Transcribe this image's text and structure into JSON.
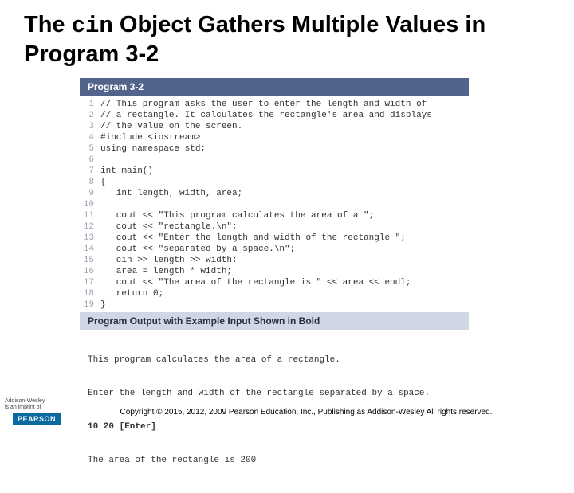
{
  "title": {
    "before": "The ",
    "mono": "cin",
    "after": " Object Gathers Multiple Values in Program 3-2"
  },
  "program_label": "Program 3-2",
  "code": [
    "// This program asks the user to enter the length and width of",
    "// a rectangle. It calculates the rectangle's area and displays",
    "// the value on the screen.",
    "#include <iostream>",
    "using namespace std;",
    "",
    "int main()",
    "{",
    "   int length, width, area;",
    "",
    "   cout << \"This program calculates the area of a \";",
    "   cout << \"rectangle.\\n\";",
    "   cout << \"Enter the length and width of the rectangle \";",
    "   cout << \"separated by a space.\\n\";",
    "   cin >> length >> width;",
    "   area = length * width;",
    "   cout << \"The area of the rectangle is \" << area << endl;",
    "   return 0;",
    "}"
  ],
  "output_label": "Program Output with Example Input Shown in Bold",
  "output": {
    "l1": "This program calculates the area of a rectangle.",
    "l2": "Enter the length and width of the rectangle separated by a space.",
    "l3_bold": "10 20 [Enter]",
    "l4": "The area of the rectangle is 200"
  },
  "brand": {
    "aw1": "Addison-Wesley",
    "aw2": "is an imprint of",
    "pearson": "PEARSON"
  },
  "copyright": "Copyright © 2015, 2012, 2009 Pearson Education, Inc., Publishing as Addison-Wesley All rights reserved."
}
